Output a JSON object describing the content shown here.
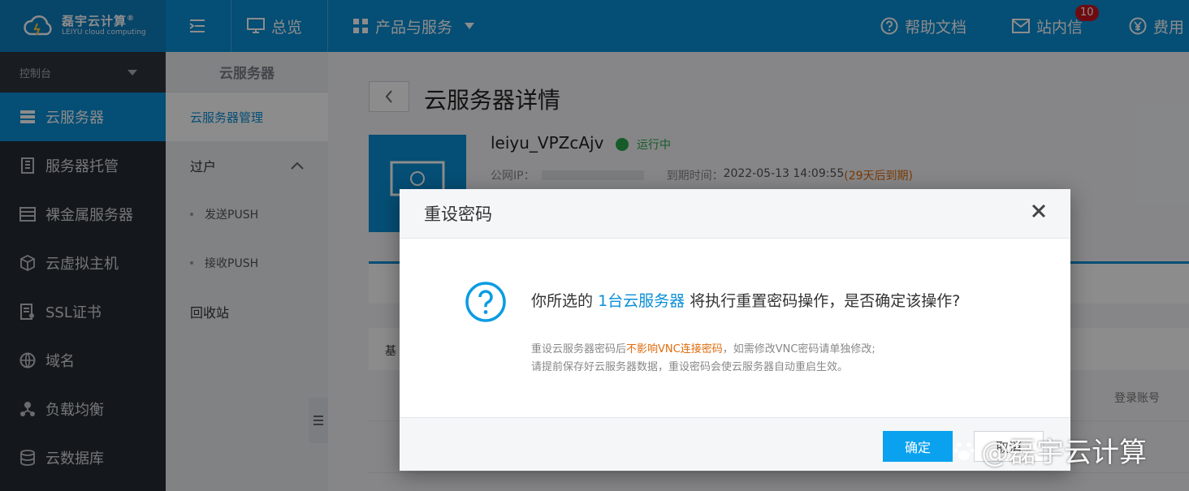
{
  "brand": {
    "name_cn": "磊宇云计算",
    "reg": "®",
    "name_en": "LEIYU cloud computing"
  },
  "topbar": {
    "overview": "总览",
    "products": "产品与服务",
    "help": "帮助文档",
    "messages": "站内信",
    "messages_badge": "10",
    "fees": "费用"
  },
  "sidebar": {
    "console": "控制台",
    "items": [
      {
        "label": "云服务器"
      },
      {
        "label": "服务器托管"
      },
      {
        "label": "裸金属服务器"
      },
      {
        "label": "云虚拟主机"
      },
      {
        "label": "SSL证书"
      },
      {
        "label": "域名"
      },
      {
        "label": "负载均衡"
      },
      {
        "label": "云数据库"
      }
    ]
  },
  "submenu": {
    "title": "云服务器",
    "manage": "云服务器管理",
    "transfer": "过户",
    "send_push": "发送PUSH",
    "receive_push": "接收PUSH",
    "recycle": "回收站"
  },
  "detail": {
    "title": "云服务器详情",
    "server_name": "leiyu_VPZcAjv",
    "status": "运行中",
    "public_ip_label": "公网IP：",
    "expire_label": "到期时间：",
    "expire_time": "2022-05-13 14:09:55",
    "expire_remaining": "(29天后到期)",
    "basic_tab": "基",
    "login_account": "登录账号"
  },
  "modal": {
    "title": "重设密码",
    "msg_prefix": "你所选的",
    "msg_highlight": "1台云服务器",
    "msg_suffix": "将执行重置密码操作，是否确定该操作?",
    "note1_prefix": "重设云服务器密码后",
    "note1_warn": "不影响VNC连接密码",
    "note1_suffix": "，如需修改VNC密码请单独修改;",
    "note2": "请提前保存好云服务器数据，重设密码会使云服务器自动重启生效。",
    "ok": "确定",
    "cancel": "取消"
  },
  "watermark": "@磊宇云计算",
  "colors": {
    "primary": "#0a8fd6",
    "sidebar": "#262c33",
    "running": "#2aa84a",
    "warning": "#e06b0a"
  }
}
